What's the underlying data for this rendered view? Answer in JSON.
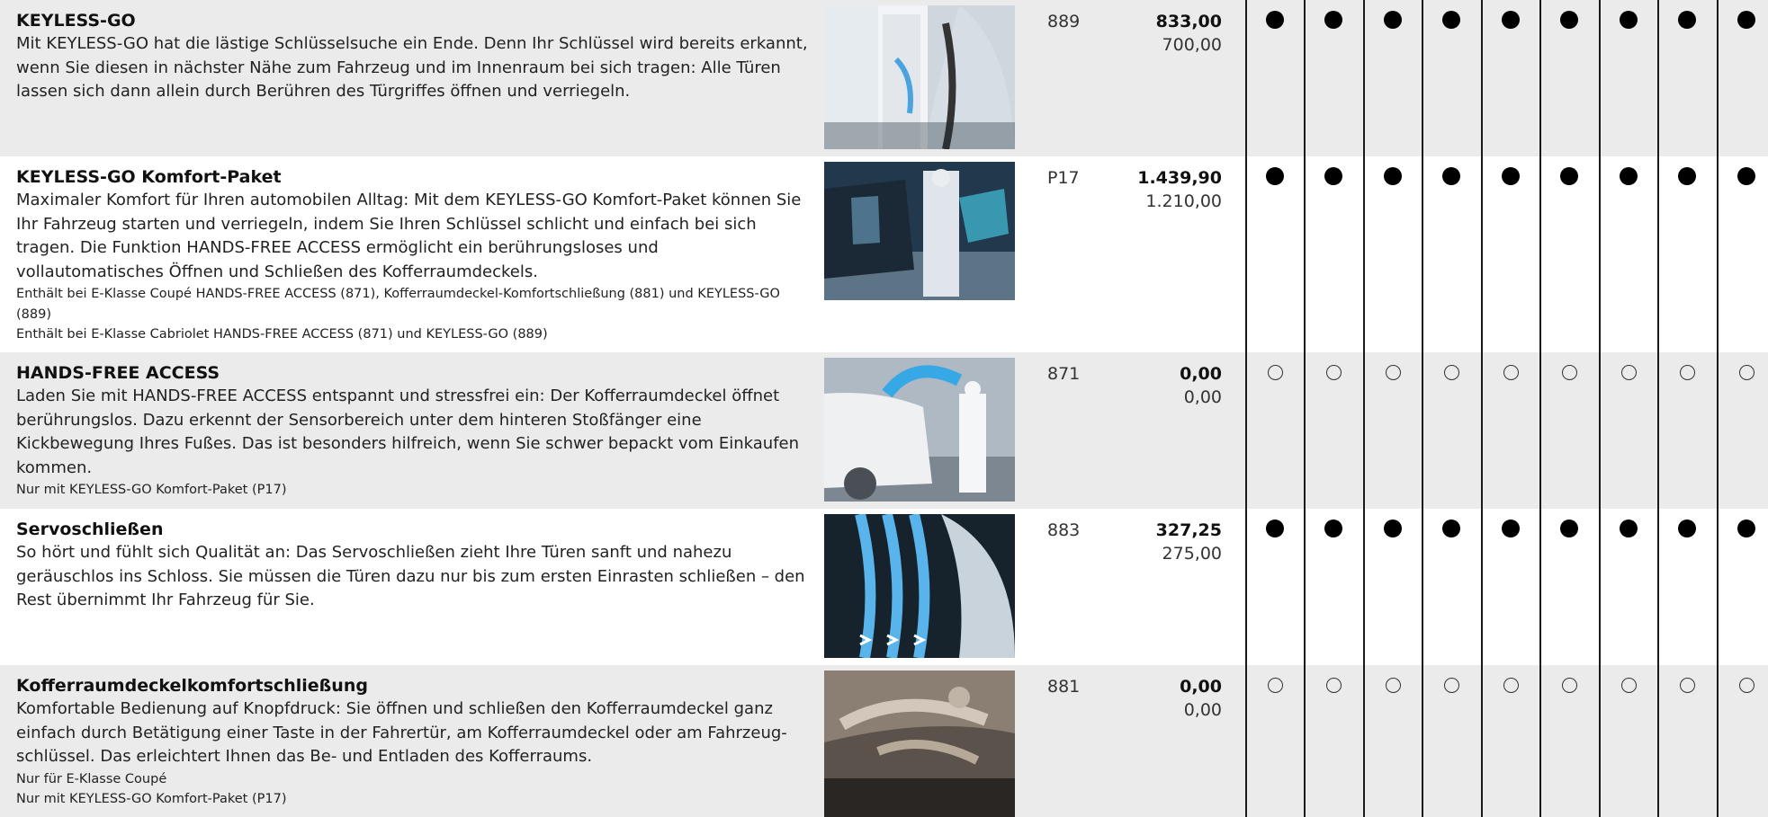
{
  "marker_columns": 9,
  "rows": [
    {
      "title": "KEYLESS-GO",
      "body": "Mit KEYLESS-GO hat die lästige Schlüsselsuche ein Ende. Denn Ihr Schlüssel wird bereits erkannt, wenn Sie diesen in nächster Nähe zum Fahrzeug und im Innenraum bei sich tragen: Alle Türen lassen sich dann allein durch Berühren des Türgriffes öffnen und verriegeln.",
      "notes": [],
      "code": "889",
      "price_gross": "833,00",
      "price_net": "700,00",
      "availability": "full",
      "image": "keyless-go-photo"
    },
    {
      "title": "KEYLESS-GO Komfort-Paket",
      "body": "Maximaler Komfort für Ihren automobilen Alltag: Mit dem KEYLESS-GO Komfort-Paket können Sie Ihr Fahrzeug starten und verriegeln, indem Sie Ihren Schlüssel schlicht und einfach bei sich tragen. Die Funktion HANDS-FREE ACCESS ermöglicht ein berührungsloses und vollautomatisches Öffnen und Schließen des Kofferraumdeckels.",
      "notes": [
        "Enthält bei E-Klasse Coupé HANDS-FREE ACCESS (871), Kofferraumdeckel-Komfortschließung (881) und KEYLESS-GO (889)",
        "Enthält bei E-Klasse Cabriolet HANDS-FREE ACCESS (871) und KEYLESS-GO (889)"
      ],
      "code": "P17",
      "price_gross": "1.439,90",
      "price_net": "1.210,00",
      "availability": "full",
      "image": "keyless-go-komfort-paket-photo"
    },
    {
      "title": "HANDS-FREE ACCESS",
      "body": "Laden Sie mit HANDS-FREE ACCESS entspannt und stressfrei ein: Der Kofferraumdeckel öffnet berührungslos. Dazu erkennt der Sensorbereich unter dem hinteren Stoßfänger eine Kickbewegung Ihres Fußes. Das ist besonders hilfreich, wenn Sie schwer bepackt vom Einkaufen kommen.",
      "notes": [
        "Nur mit KEYLESS-GO Komfort-Paket (P17)"
      ],
      "code": "871",
      "price_gross": "0,00",
      "price_net": "0,00",
      "availability": "optional",
      "image": "hands-free-access-photo"
    },
    {
      "title": "Servoschließen",
      "body": "So hört und fühlt sich Qualität an: Das Servoschließen zieht Ihre Türen sanft und nahezu geräuschlos ins Schloss. Sie müssen die Türen dazu nur bis zum ersten Einrasten schließen – den Rest übernimmt Ihr Fahrzeug für Sie.",
      "notes": [],
      "code": "883",
      "price_gross": "327,25",
      "price_net": "275,00",
      "availability": "full",
      "image": "servoschliessen-photo"
    },
    {
      "title": "Kofferraumdeckelkomfortschließung",
      "body": "Komfortable Bedienung auf Knopfdruck: Sie öffnen und schließen den Kofferraumdeckel ganz einfach durch Betätigung einer Taste in der Fahrertür, am Kofferraumdeckel oder am Fahrzeug-schlüssel. Das erleichtert Ihnen das Be- und Entladen des Kofferraums.",
      "notes": [
        "Nur für E-Klasse Coupé",
        "Nur mit KEYLESS-GO Komfort-Paket (P17)"
      ],
      "code": "881",
      "price_gross": "0,00",
      "price_net": "0,00",
      "availability": "optional",
      "image": "kofferraumdeckel-photo"
    }
  ]
}
